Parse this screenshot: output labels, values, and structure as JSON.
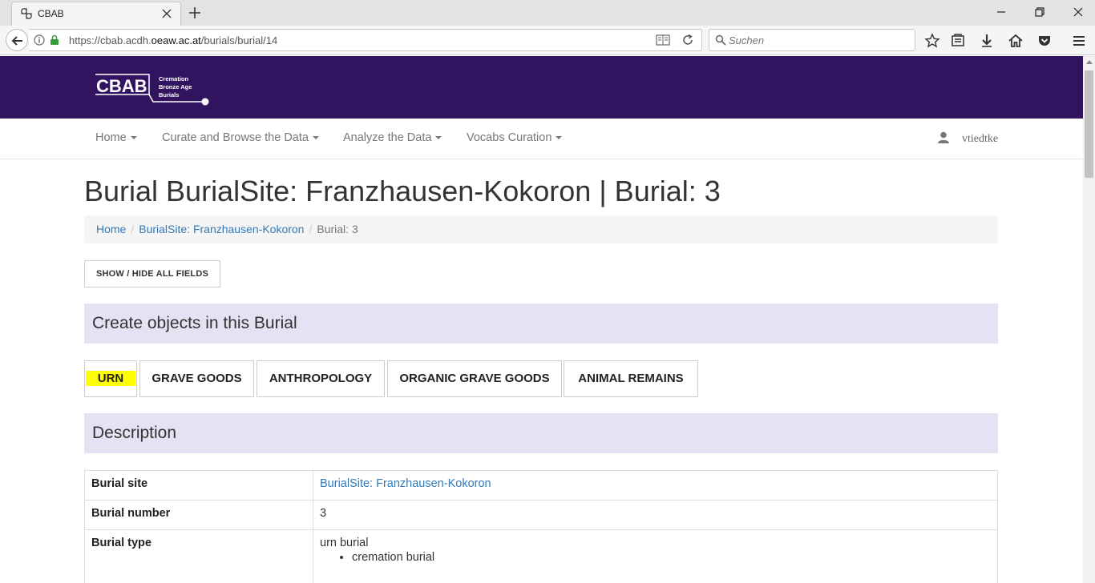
{
  "browser": {
    "tab_title": "CBAB",
    "url_prefix": "https://cbab.acdh.",
    "url_domain": "oeaw.ac.at",
    "url_path": "/burials/burial/14",
    "search_placeholder": "Suchen"
  },
  "site": {
    "brand_colors": {
      "header": "#321360",
      "section": "#e3e3f3",
      "link": "#337ab7",
      "highlight": "#ffff00"
    },
    "logo": {
      "text": "CBAB",
      "line1": "Cremation",
      "line2": "Bronze Age",
      "line3": "Burials"
    },
    "nav": [
      {
        "label": "Home"
      },
      {
        "label": "Curate and Browse the Data"
      },
      {
        "label": "Analyze the Data"
      },
      {
        "label": "Vocabs Curation"
      }
    ],
    "username": "vtiedtke"
  },
  "page": {
    "title": "Burial BurialSite: Franzhausen-Kokoron | Burial: 3",
    "breadcrumb": [
      "Home",
      "BurialSite: Franzhausen-Kokoron",
      "Burial: 3"
    ],
    "toggle_label": "SHOW / HIDE ALL FIELDS",
    "create_section_title": "Create objects in this Burial",
    "create_buttons": [
      "URN",
      "GRAVE GOODS",
      "ANTHROPOLOGY",
      "ORGANIC GRAVE GOODS",
      "ANIMAL REMAINS"
    ],
    "description_title": "Description",
    "description_rows": [
      {
        "label": "Burial site",
        "value": "BurialSite: Franzhausen-Kokoron"
      },
      {
        "label": "Burial number",
        "value": "3"
      },
      {
        "label": "Burial type",
        "value": "urn burial",
        "sub": "cremation burial"
      }
    ]
  }
}
